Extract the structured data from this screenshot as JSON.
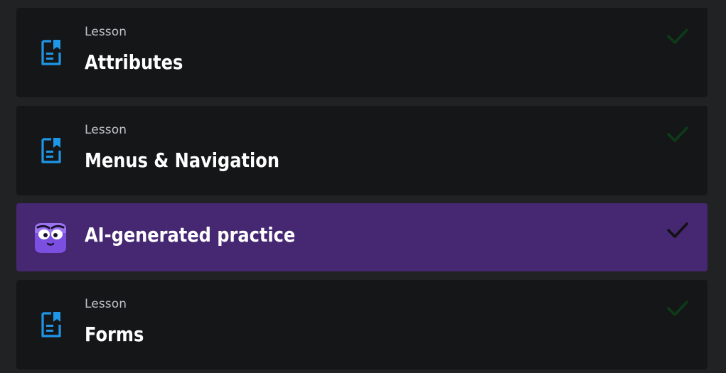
{
  "items": [
    {
      "kind": "lesson",
      "eyebrow": "Lesson",
      "title": "Attributes",
      "icon": "lesson-document-icon",
      "status": "completed"
    },
    {
      "kind": "lesson",
      "eyebrow": "Lesson",
      "title": "Menus & Navigation",
      "icon": "lesson-document-icon",
      "status": "completed"
    },
    {
      "kind": "practice",
      "title": "AI-generated practice",
      "icon": "ai-mascot-icon",
      "status": "completed"
    },
    {
      "kind": "lesson",
      "eyebrow": "Lesson",
      "title": "Forms",
      "icon": "lesson-document-icon",
      "status": "completed"
    }
  ],
  "colors": {
    "page_background": "#202224",
    "card_background": "#151617",
    "practice_background": "#462772",
    "lesson_icon": "#1e97e8",
    "check_done_dim": "#0d3a18",
    "check_practice": "#111111"
  }
}
